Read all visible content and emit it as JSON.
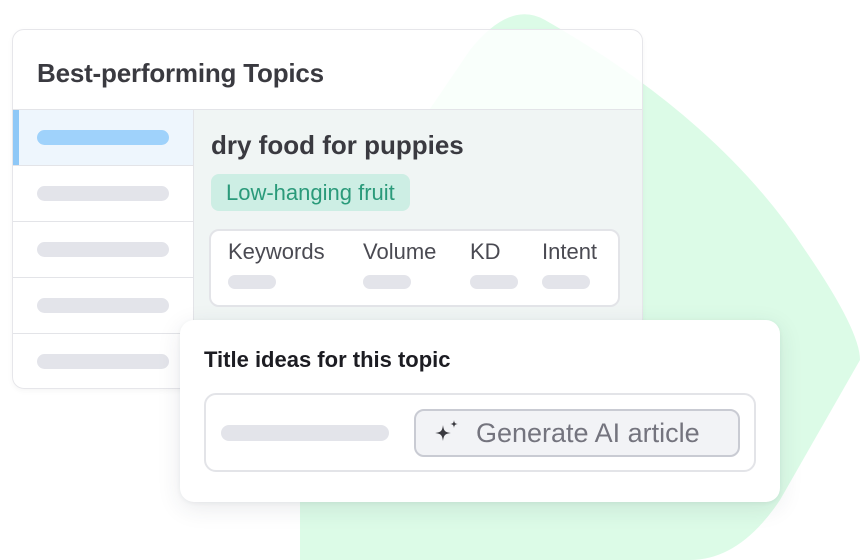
{
  "colors": {
    "accent_green_shape": "#dcfbe7",
    "active_row": "#eef6fd",
    "active_bar": "#8ec8f7",
    "badge_bg": "#cdeee4",
    "badge_text": "#2a9a7a"
  },
  "topics_card": {
    "title": "Best-performing Topics",
    "rows": [
      {
        "active": true
      },
      {
        "active": false
      },
      {
        "active": false
      },
      {
        "active": false
      },
      {
        "active": false
      }
    ]
  },
  "topic_detail": {
    "name": "dry food for puppies",
    "badge": "Low-hanging fruit",
    "metrics": [
      {
        "label": "Keywords"
      },
      {
        "label": "Volume"
      },
      {
        "label": "KD"
      },
      {
        "label": "Intent"
      }
    ]
  },
  "ideas_card": {
    "title": "Title ideas for this topic",
    "button_label": "Generate AI article",
    "button_icon": "sparkle-icon"
  }
}
